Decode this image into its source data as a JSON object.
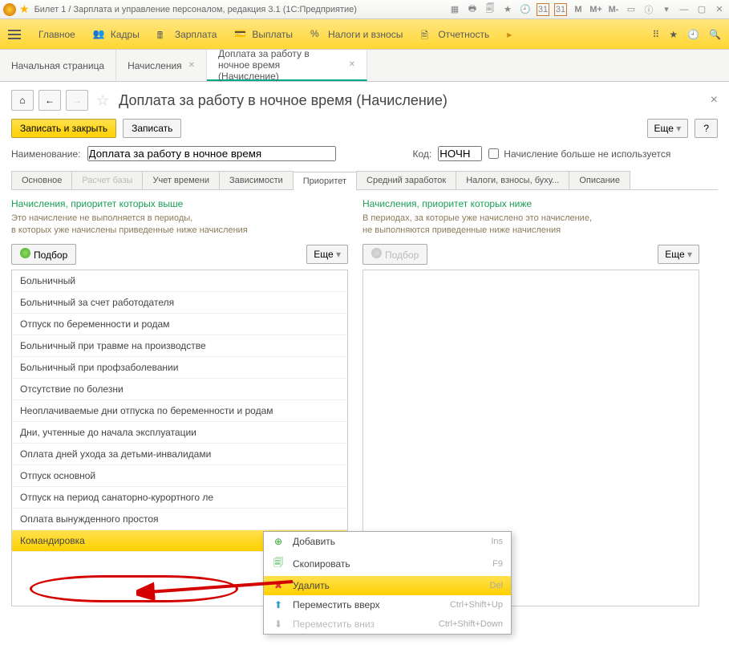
{
  "titlebar": {
    "title": "Билет 1 / Зарплата и управление персоналом, редакция 3.1  (1С:Предприятие)",
    "m": "M",
    "mplus": "M+",
    "mminus": "M-",
    "cal": "31"
  },
  "menu": {
    "main": "Главное",
    "kadry": "Кадры",
    "zp": "Зарплата",
    "vyp": "Выплаты",
    "nalogi": "Налоги и взносы",
    "otch": "Отчетность"
  },
  "tabs": {
    "start": "Начальная страница",
    "nach": "Начисления",
    "current": "Доплата за работу в ночное время (Начисление)"
  },
  "header": {
    "title": "Доплата за работу в ночное время (Начисление)"
  },
  "actions": {
    "saveclose": "Записать и закрыть",
    "save": "Записать",
    "more": "Еще",
    "help": "?"
  },
  "fields": {
    "name_label": "Наименование:",
    "name_value": "Доплата за работу в ночное время",
    "code_label": "Код:",
    "code_value": "НОЧН",
    "chk_label": "Начисление больше не используется"
  },
  "innertabs": {
    "osn": "Основное",
    "baza": "Расчет базы",
    "uchet": "Учет времени",
    "zav": "Зависимости",
    "prio": "Приоритет",
    "sred": "Средний заработок",
    "nalogi": "Налоги, взносы, буху...",
    "opis": "Описание"
  },
  "left": {
    "title": "Начисления, приоритет которых выше",
    "desc1": "Это начисление не выполняется в периоды,",
    "desc2": "в которых уже начислены приведенные ниже начисления",
    "podbor": "Подбор",
    "more": "Еще",
    "items": [
      "Больничный",
      "Больничный за счет работодателя",
      "Отпуск по беременности и родам",
      "Больничный при травме на производстве",
      "Больничный при профзаболевании",
      "Отсутствие по болезни",
      "Неоплачиваемые дни отпуска по беременности и родам",
      "Дни, учтенные до начала эксплуатации",
      "Оплата дней ухода за детьми-инвалидами",
      "Отпуск основной",
      "Отпуск на период санаторно-курортного ле",
      "Оплата вынужденного простоя",
      "Командировка"
    ]
  },
  "right": {
    "title": "Начисления, приоритет которых ниже",
    "desc1": "В периодах, за которые уже начислено это начисление,",
    "desc2": "не выполняются приведенные ниже начисления",
    "podbor": "Подбор",
    "more": "Еще"
  },
  "ctx": {
    "add": "Добавить",
    "add_key": "Ins",
    "copy": "Скопировать",
    "copy_key": "F9",
    "del": "Удалить",
    "del_key": "Del",
    "up": "Переместить вверх",
    "up_key": "Ctrl+Shift+Up",
    "down": "Переместить вниз",
    "down_key": "Ctrl+Shift+Down"
  }
}
